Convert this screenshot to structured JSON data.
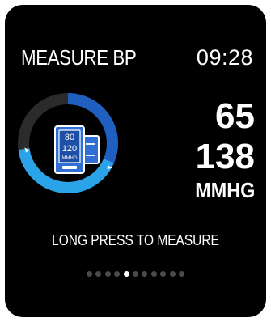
{
  "header": {
    "title": "MEASURE BP",
    "time": "09:28"
  },
  "icon": {
    "name": "blood-pressure-monitor-icon",
    "line1": "80",
    "line2": "120",
    "line3": "MMHG"
  },
  "readings": {
    "value_a": "65",
    "value_b": "138",
    "unit": "MMHG"
  },
  "hint": "LONG PRESS TO MEASURE",
  "pager": {
    "total": 11,
    "active_index": 4
  },
  "colors": {
    "background": "#000000",
    "ring_track": "#2b2b2b",
    "ring_dark_blue": "#1f5fbf",
    "ring_light_blue": "#2aa3e8",
    "text": "#ffffff",
    "dot_inactive": "#4a4a4a",
    "dot_active": "#ffffff"
  }
}
